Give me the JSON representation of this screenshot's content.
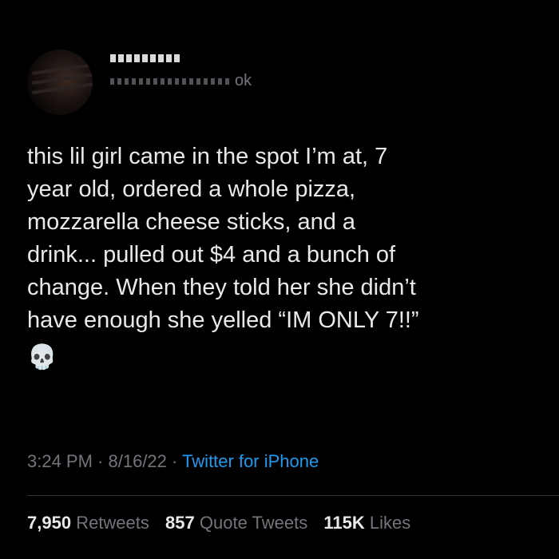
{
  "author": {
    "display_name_visible": "ıαyu.",
    "handle_visible": "ok"
  },
  "tweet": {
    "lines": [
      "this lil girl came in the spot I’m at, 7",
      "year old, ordered a whole pizza,",
      "mozzarella cheese sticks, and a",
      "drink... pulled out $4 and a bunch of",
      "change. When they told her she didn’t",
      "have enough she yelled “IM ONLY 7!!”"
    ],
    "emoji": "💀",
    "emoji_name": "skull-icon"
  },
  "meta": {
    "time": "3:24 PM",
    "sep1": " · ",
    "date": "8/16/22",
    "sep2": " · ",
    "source": "Twitter for iPhone"
  },
  "stats": {
    "retweets_count": "7,950",
    "retweets_label": "Retweets",
    "quotes_count": "857",
    "quotes_label": "Quote Tweets",
    "likes_count": "115K",
    "likes_label": "Likes"
  },
  "colors": {
    "background": "#000000",
    "text": "#e7e9ea",
    "muted": "#71767b",
    "link": "#1d9bf0"
  }
}
